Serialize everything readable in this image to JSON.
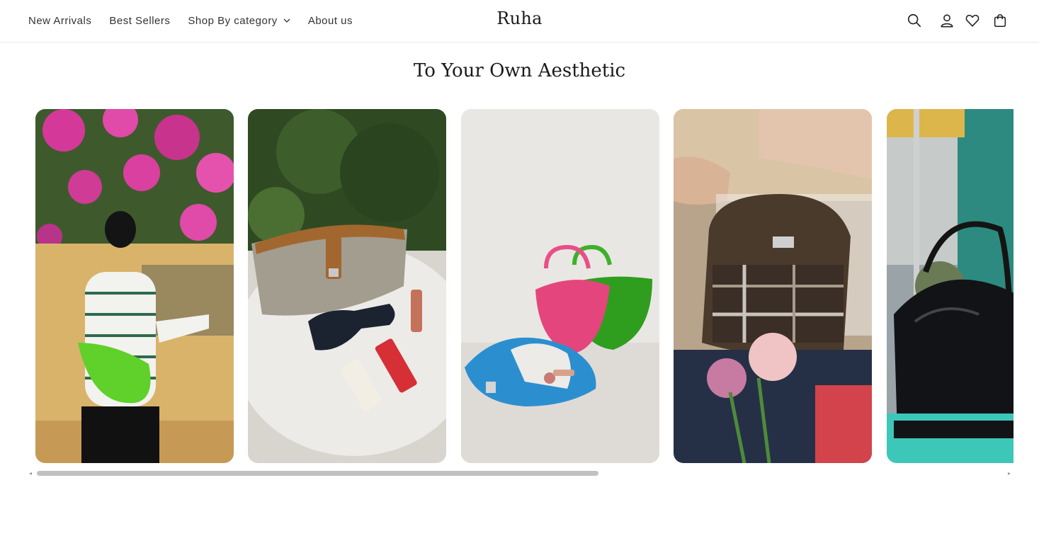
{
  "header": {
    "nav": [
      {
        "label": "New Arrivals"
      },
      {
        "label": "Best Sellers"
      },
      {
        "label": "Shop By category",
        "has_dropdown": true
      },
      {
        "label": "About us"
      }
    ],
    "logo": "Ruha",
    "icons": [
      "search-icon",
      "account-icon",
      "wishlist-heart-icon",
      "cart-icon"
    ]
  },
  "section": {
    "title": "To Your Own Aesthetic"
  },
  "carousel": {
    "cards": [
      {
        "subject": "woman in striped top with green shoulder bag among pink flowers"
      },
      {
        "subject": "tan canvas bag with sunglasses and cosmetics on white table"
      },
      {
        "subject": "pink, green and blue crescent bags"
      },
      {
        "subject": "brown plaid bag held on lap with flowers"
      },
      {
        "subject": "black leather shoulder bag in street scene"
      }
    ],
    "scroll_progress": 0.58
  },
  "colors": {
    "text": "#333333",
    "divider": "#e8e8e8",
    "scrollbar": "#c1c1c1"
  }
}
